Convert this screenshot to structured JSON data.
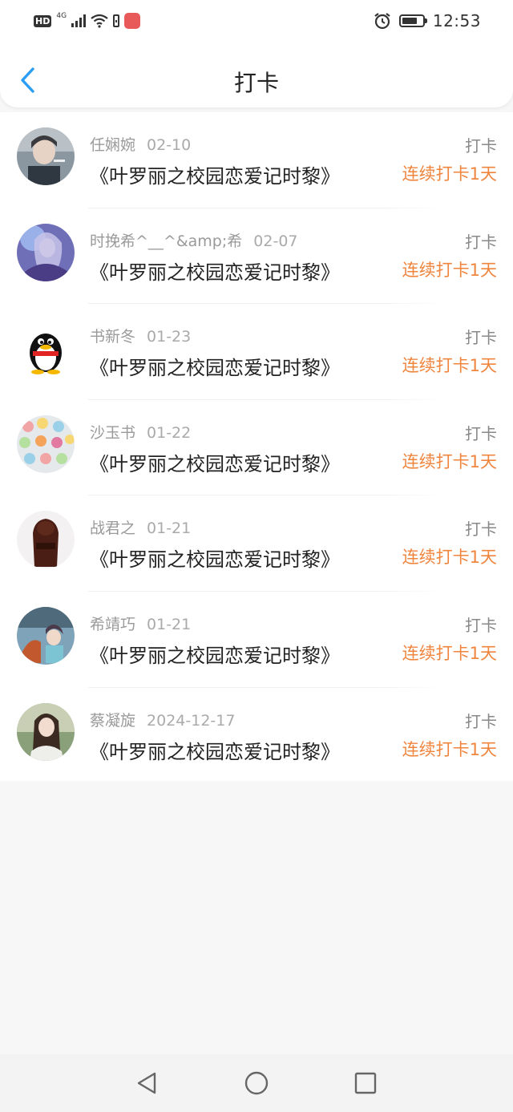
{
  "status_bar": {
    "hd": "HD",
    "network": "4G",
    "time": "12:53"
  },
  "header": {
    "title": "打卡"
  },
  "entries": [
    {
      "name": "任娴婉",
      "date": "02-10",
      "book": "《叶罗丽之校园恋爱记时黎》",
      "tag": "打卡",
      "streak": "连续打卡1天"
    },
    {
      "name": "时挽希^__^&amp;希",
      "date": "02-07",
      "book": "《叶罗丽之校园恋爱记时黎》",
      "tag": "打卡",
      "streak": "连续打卡1天"
    },
    {
      "name": "书新冬",
      "date": "01-23",
      "book": "《叶罗丽之校园恋爱记时黎》",
      "tag": "打卡",
      "streak": "连续打卡1天"
    },
    {
      "name": "沙玉书",
      "date": "01-22",
      "book": "《叶罗丽之校园恋爱记时黎》",
      "tag": "打卡",
      "streak": "连续打卡1天"
    },
    {
      "name": "战君之",
      "date": "01-21",
      "book": "《叶罗丽之校园恋爱记时黎》",
      "tag": "打卡",
      "streak": "连续打卡1天"
    },
    {
      "name": "希靖巧",
      "date": "01-21",
      "book": "《叶罗丽之校园恋爱记时黎》",
      "tag": "打卡",
      "streak": "连续打卡1天"
    },
    {
      "name": "蔡凝旋",
      "date": "2024-12-17",
      "book": "《叶罗丽之校园恋爱记时黎》",
      "tag": "打卡",
      "streak": "连续打卡1天"
    }
  ],
  "colors": {
    "accent_blue": "#2a9df4",
    "streak_orange": "#f0853e"
  }
}
